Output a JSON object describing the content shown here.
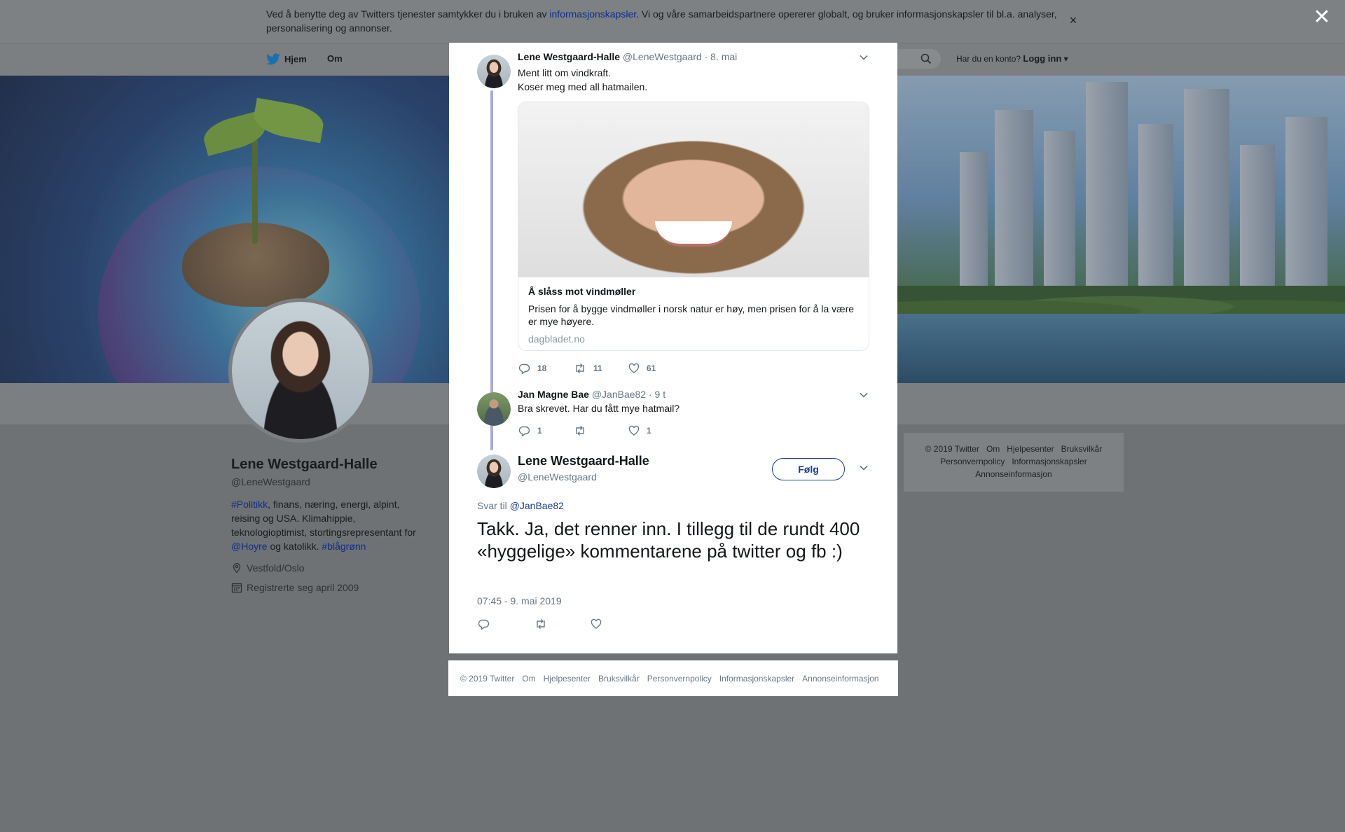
{
  "cookie_banner": {
    "text_before": "Ved å benytte deg av Twitters tjenester samtykker du i bruken av ",
    "link": "informasjonskapsler",
    "text_after": ". Vi og våre samarbeidspartnere opererer globalt, og bruker informasjonskapsler til bl.a. analyser, personalisering og annonser.",
    "close": "×"
  },
  "overlay_close": "✕",
  "nav": {
    "home": "Hjem",
    "about": "Om",
    "login_question": "Har du en konto?",
    "login": "Logg inn"
  },
  "profile": {
    "name": "Lene Westgaard-Halle",
    "handle": "@LeneWestgaard",
    "bio_tag1": "#Politikk",
    "bio_text1": ", finans, næring, energi, alpint, reising og USA. Klimahippie, teknologioptimist, stortingsrepresentant for ",
    "bio_mention": "@Hoyre",
    "bio_text2": " og katolikk. ",
    "bio_tag2": "#blågrønn",
    "location": "Vestfold/Oslo",
    "joined": "Registrerte seg april 2009"
  },
  "bg_footer": {
    "row1": [
      "© 2019 Twitter",
      "Om",
      "Hjelpesenter",
      "Bruksvilkår"
    ],
    "row2": [
      "Personvernpolicy",
      "Informasjonskapsler"
    ],
    "row3": [
      "Annonseinformasjon"
    ]
  },
  "tweet1": {
    "name": "Lene Westgaard-Halle",
    "handle": "@LeneWestgaard",
    "date": "· 8. mai",
    "line1": "Ment litt om vindkraft.",
    "line2": "Koser meg med all hatmailen.",
    "card": {
      "title": "Å slåss mot vindmøller",
      "description": "Prisen for å bygge vindmøller i norsk natur er høy, men prisen for å la være er mye høyere.",
      "domain": "dagbladet.no"
    },
    "replies": "18",
    "retweets": "11",
    "likes": "61"
  },
  "tweet2": {
    "name": "Jan Magne Bae",
    "handle": "@JanBae82",
    "date": "· 9 t",
    "text": "Bra skrevet. Har du fått mye hatmail?",
    "replies": "1",
    "likes": "1"
  },
  "tweet3": {
    "name": "Lene Westgaard-Halle",
    "handle": "@LeneWestgaard",
    "follow": "Følg",
    "reply_label": "Svar til",
    "reply_to": "@JanBae82",
    "text": "Takk. Ja, det renner inn. I tillegg til de rundt 400 «hyggelige» kommentarene på twitter og fb :)",
    "timestamp": "07:45 - 9. mai 2019"
  },
  "modal_footer": [
    "© 2019 Twitter",
    "Om",
    "Hjelpesenter",
    "Bruksvilkår",
    "Personvernpolicy",
    "Informasjonskapsler",
    "Annonseinformasjon"
  ],
  "colors": {
    "link": "#1b3b9a",
    "thread_line": "#a9acd8",
    "twitter_blue": "#1da1f2"
  },
  "icons": [
    "twitter-bird-icon",
    "search-icon",
    "caret-down-icon",
    "location-icon",
    "calendar-icon",
    "reply-icon",
    "retweet-icon",
    "like-icon",
    "chevron-down-icon",
    "close-icon"
  ]
}
